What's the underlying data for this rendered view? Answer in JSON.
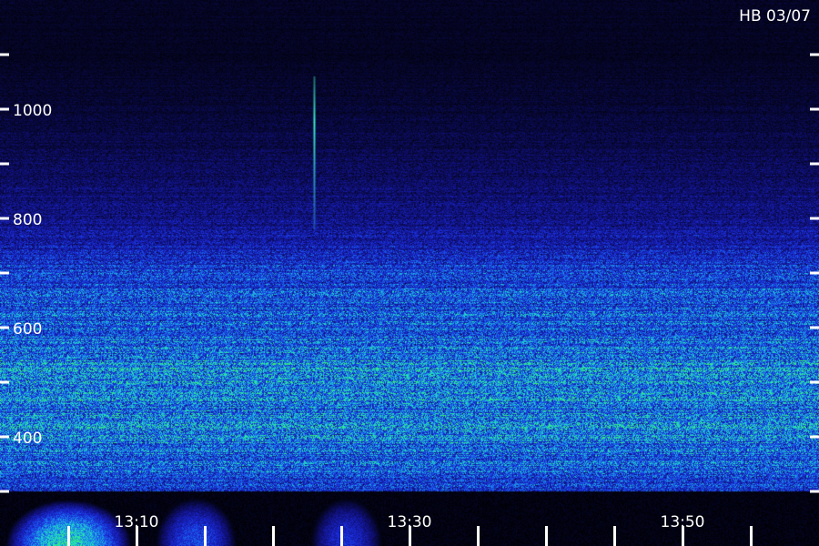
{
  "chart_data": {
    "type": "heatmap",
    "title": "HB 03/07",
    "xlabel": "",
    "ylabel": "",
    "x_tick_labels": [
      "13:10",
      "13:30",
      "13:50"
    ],
    "y_tick_labels": [
      "400",
      "600",
      "800",
      "1000"
    ],
    "x_range_minutes": [
      "13:02",
      "13:59"
    ],
    "y_range_hz": [
      300,
      1100
    ],
    "x_minor_tick_interval_min": 5,
    "y_minor_tick_interval_hz": 100,
    "grid": false,
    "colormap": [
      "#000000",
      "#10107a",
      "#1a2ad8",
      "#1a7af0",
      "#20e0c8",
      "#3cf060"
    ],
    "background_color": "#000000",
    "tick_color": "#ffffff",
    "spectral_profile_hz": [
      {
        "hz": 300,
        "level": 0.55
      },
      {
        "hz": 340,
        "level": 0.7
      },
      {
        "hz": 380,
        "level": 0.78
      },
      {
        "hz": 420,
        "level": 0.85
      },
      {
        "hz": 460,
        "level": 0.8
      },
      {
        "hz": 500,
        "level": 0.82
      },
      {
        "hz": 520,
        "level": 0.9
      },
      {
        "hz": 560,
        "level": 0.78
      },
      {
        "hz": 600,
        "level": 0.72
      },
      {
        "hz": 650,
        "level": 0.66
      },
      {
        "hz": 700,
        "level": 0.6
      },
      {
        "hz": 750,
        "level": 0.45
      },
      {
        "hz": 800,
        "level": 0.3
      },
      {
        "hz": 900,
        "level": 0.2
      },
      {
        "hz": 1000,
        "level": 0.12
      },
      {
        "hz": 1100,
        "level": 0.08
      }
    ],
    "events": [
      {
        "time": "13:23",
        "hz_low": 780,
        "hz_high": 1060,
        "kind": "vertical-line"
      }
    ]
  }
}
